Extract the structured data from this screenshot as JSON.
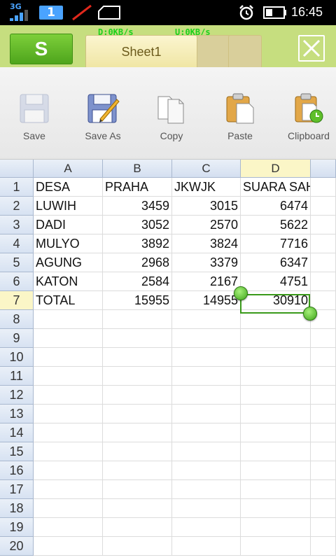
{
  "status_bar": {
    "network": "3G",
    "notification_count": "1",
    "time": "16:45"
  },
  "header": {
    "net_down": "D:0KB/s",
    "net_up": "U:0KB/s",
    "logo": "S",
    "active_sheet": "Sheet1"
  },
  "toolbar": [
    {
      "label": "Save",
      "icon": "save-icon"
    },
    {
      "label": "Save As",
      "icon": "save-as-icon"
    },
    {
      "label": "Copy",
      "icon": "copy-icon"
    },
    {
      "label": "Paste",
      "icon": "paste-icon"
    },
    {
      "label": "Clipboard",
      "icon": "clipboard-icon"
    }
  ],
  "sheet": {
    "columns": [
      "A",
      "B",
      "C",
      "D"
    ],
    "selected_column": "D",
    "selected_row": "7",
    "row_numbers": [
      "1",
      "2",
      "3",
      "4",
      "5",
      "6",
      "7",
      "8",
      "9",
      "10",
      "11",
      "12",
      "13",
      "14",
      "15",
      "16",
      "17",
      "18",
      "19",
      "20"
    ],
    "rows": [
      [
        "DESA",
        "PRAHA",
        "JKWJK",
        "SUARA SAH"
      ],
      [
        "LUWIH",
        "3459",
        "3015",
        "6474"
      ],
      [
        "DADI",
        "3052",
        "2570",
        "5622"
      ],
      [
        "MULYO",
        "3892",
        "3824",
        "7716"
      ],
      [
        "AGUNG",
        "2968",
        "3379",
        "6347"
      ],
      [
        "KATON",
        "2584",
        "2167",
        "4751"
      ],
      [
        "TOTAL",
        "15955",
        "14955",
        "30910"
      ]
    ]
  },
  "colors": {
    "accent_green": "#4ea51c",
    "header_bg": "#c6de7f",
    "selection": "#3a9a1a"
  }
}
